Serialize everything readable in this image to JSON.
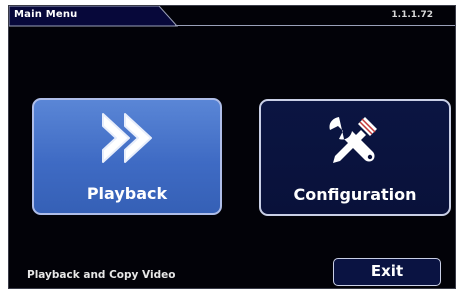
{
  "header": {
    "title": "Main Menu",
    "version": "1.1.1.72"
  },
  "tiles": [
    {
      "label": "Playback",
      "icon": "fast-forward-icon",
      "state": "selected"
    },
    {
      "label": "Configuration",
      "icon": "wrench-screwdriver-icon",
      "state": "normal"
    }
  ],
  "footer": {
    "hint": "Playback and Copy Video",
    "exit_label": "Exit"
  },
  "colors": {
    "background": "#020208",
    "selected_tile": "#4670c8",
    "normal_tile": "#0a1340",
    "border": "#c9cfe6",
    "text": "#ffffff"
  }
}
